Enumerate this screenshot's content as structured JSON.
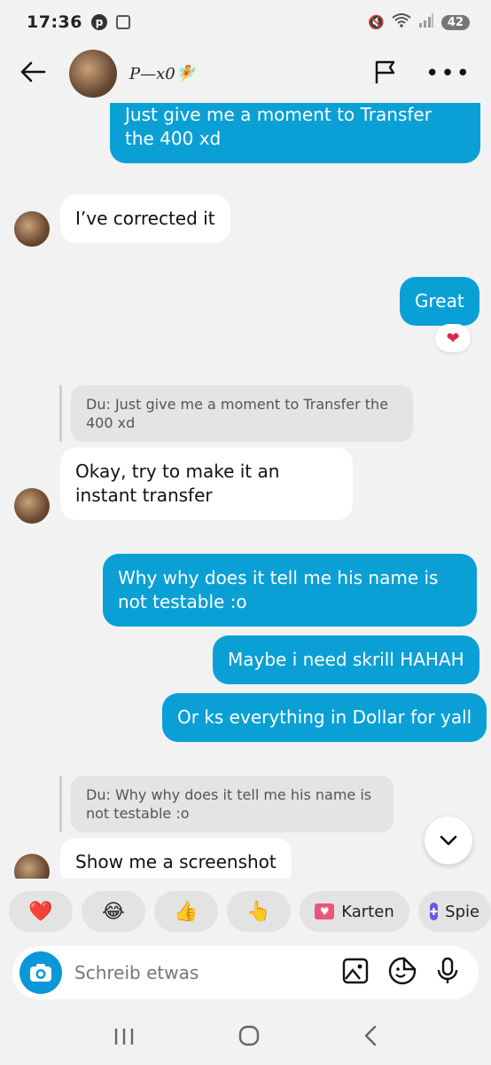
{
  "status": {
    "time": "17:36",
    "battery": "42"
  },
  "header": {
    "contact_name": "P—x0🧚"
  },
  "messages": [
    {
      "dir": "out",
      "text": "Just give me a moment to Transfer the 400 xd"
    },
    {
      "dir": "in",
      "text": "I’ve corrected it"
    },
    {
      "dir": "out",
      "text": "Great",
      "reaction": "❤"
    },
    {
      "dir": "in",
      "quote": "Du: Just give me a moment to Transfer the 400 xd",
      "text": "Okay, try to make it an instant transfer"
    },
    {
      "dir": "out",
      "text": "Why why does it tell me his name is not testable :o"
    },
    {
      "dir": "out",
      "text": "Maybe i need skrill HAHAH"
    },
    {
      "dir": "out",
      "text": "Or ks everything in Dollar for yall"
    },
    {
      "dir": "in",
      "quote": "Du: Why why does it tell me his name is not testable :o",
      "text": "Show me a screenshot"
    }
  ],
  "quick_replies": [
    {
      "emoji": "❤️"
    },
    {
      "emoji": "😂"
    },
    {
      "emoji": "👍"
    },
    {
      "emoji": "👆"
    },
    {
      "label": "Karten"
    },
    {
      "label": "Spie"
    }
  ],
  "composer": {
    "placeholder": "Schreib etwas"
  },
  "colors": {
    "outgoing_bubble": "#0aa0d6",
    "incoming_bubble": "#ffffff",
    "background": "#f2f2f2",
    "camera_button": "#0a98d8"
  }
}
